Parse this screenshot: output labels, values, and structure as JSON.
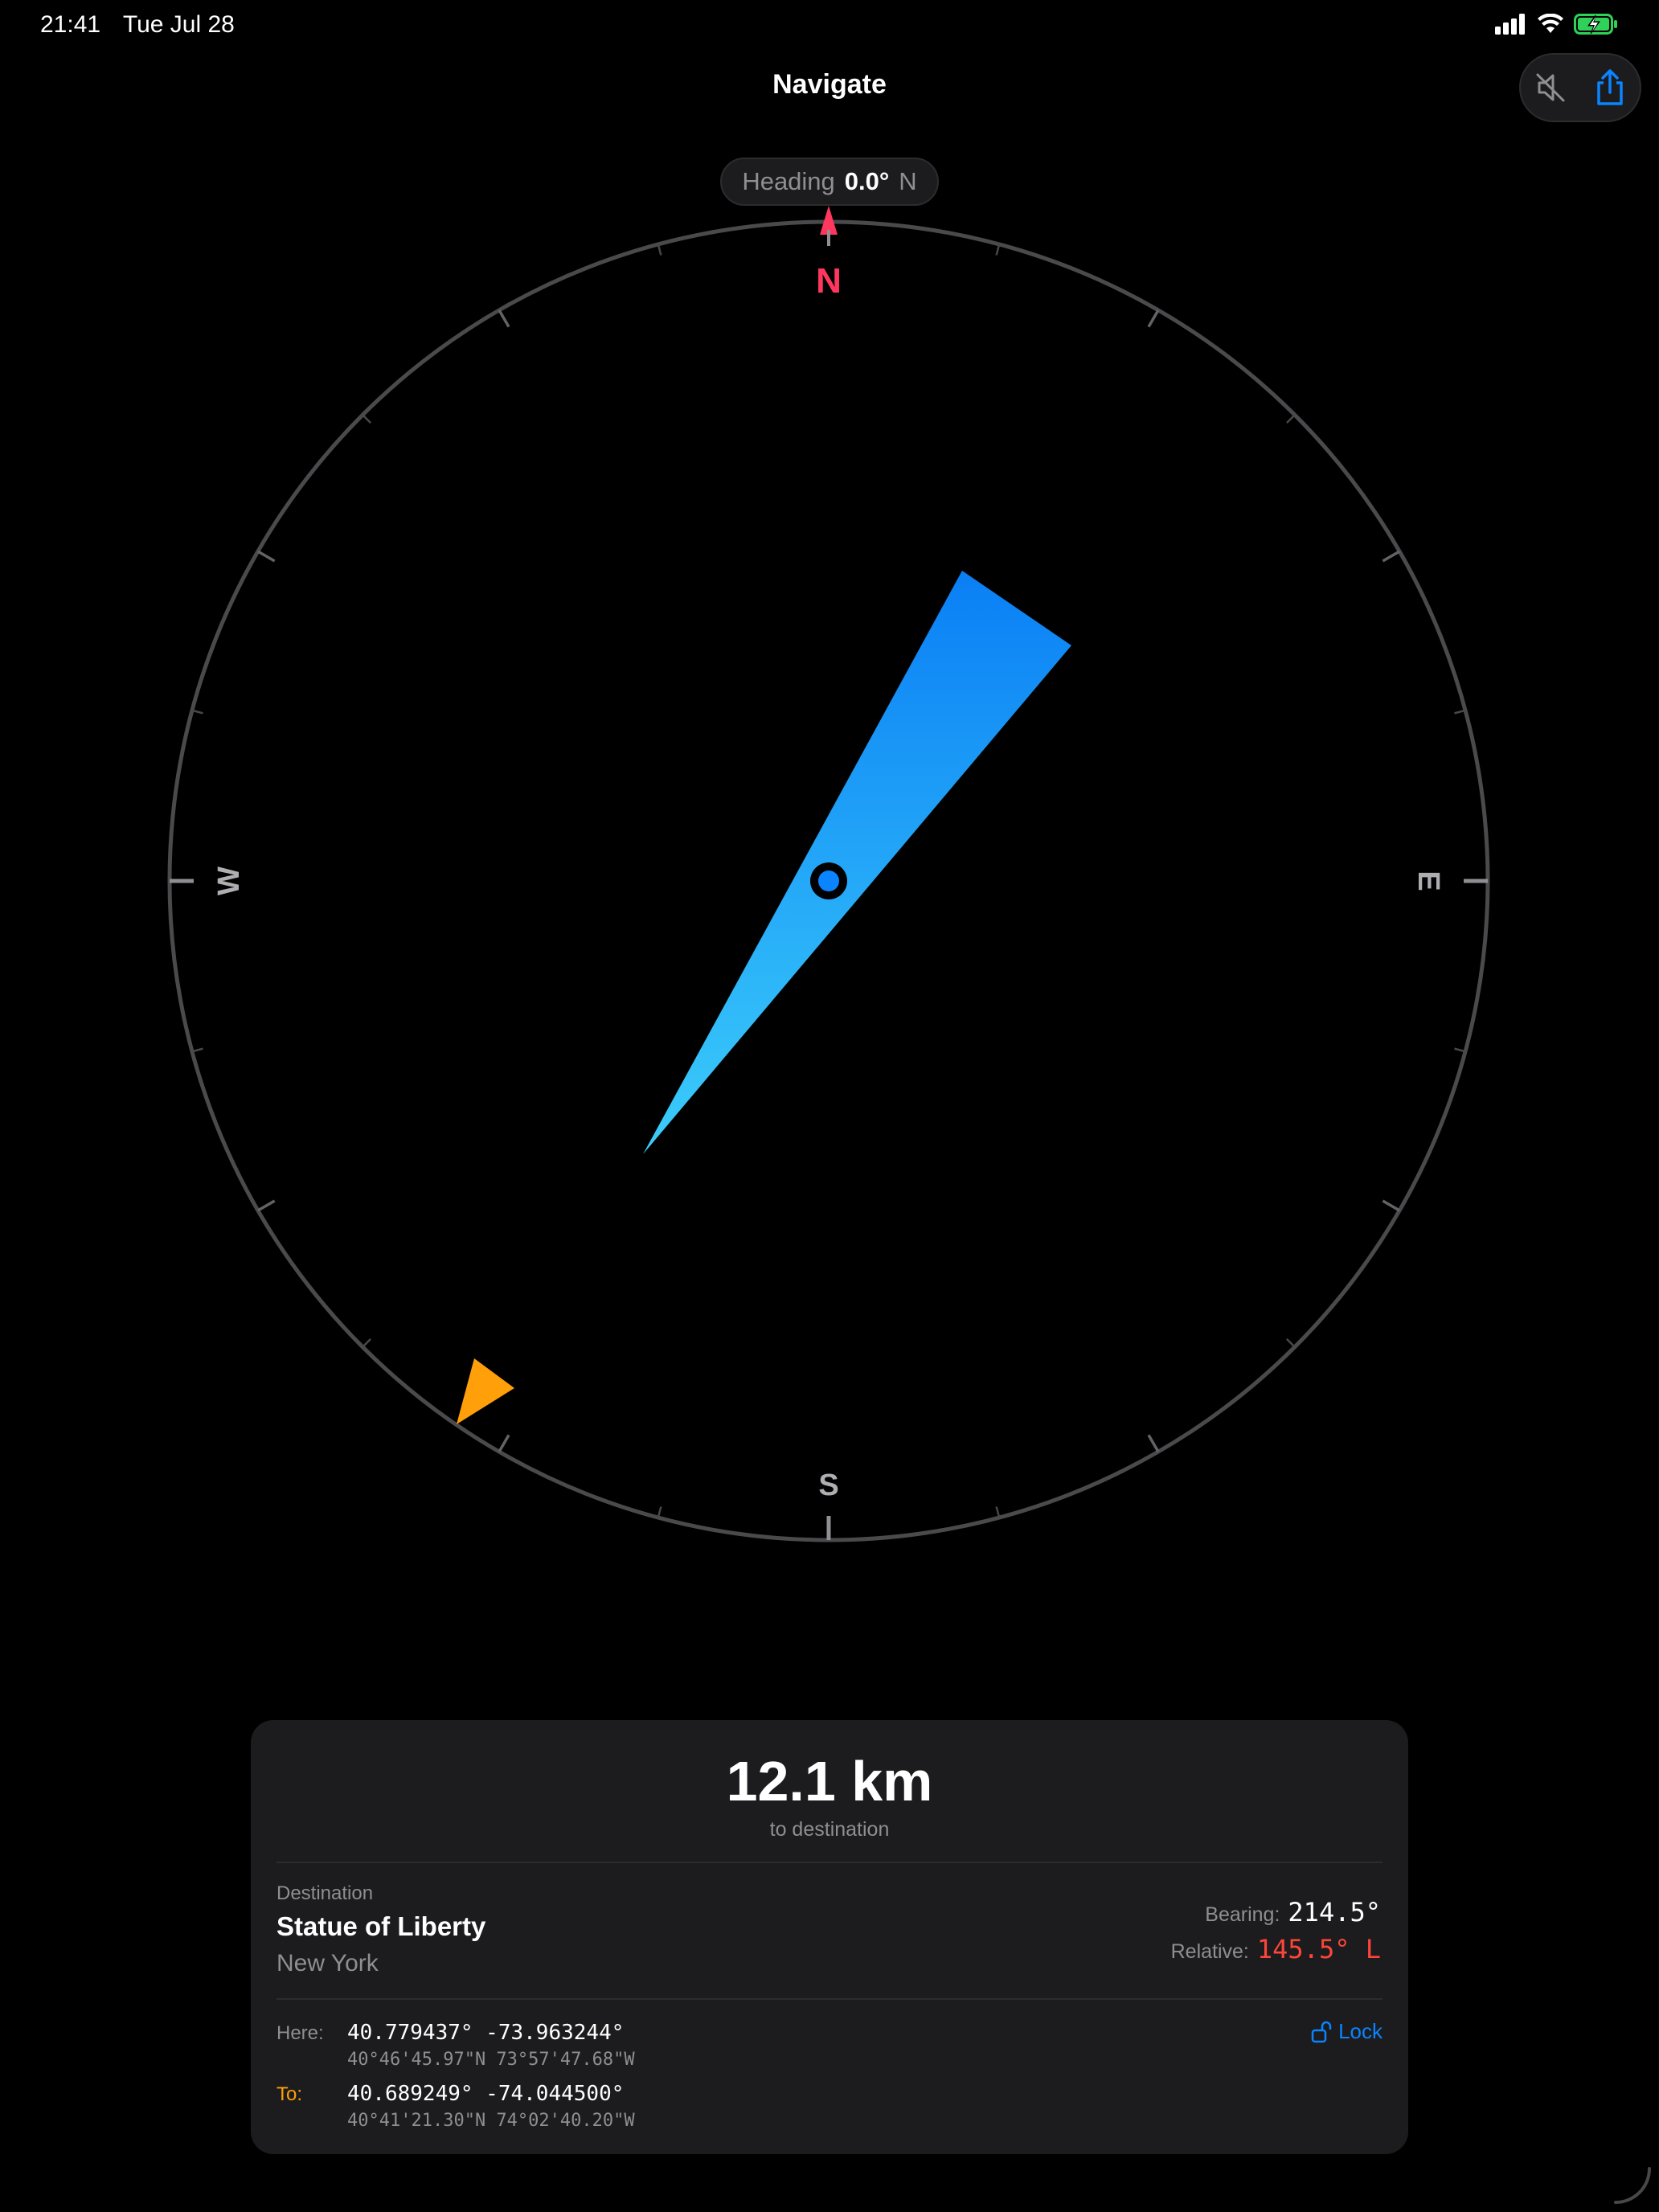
{
  "status_bar": {
    "time": "21:41",
    "date": "Tue Jul 28"
  },
  "nav": {
    "title": "Navigate"
  },
  "toolbar": {
    "mute_icon": "speaker-slash-icon",
    "share_icon": "share-icon"
  },
  "heading": {
    "label": "Heading",
    "value": "0.0°",
    "direction": "N"
  },
  "compass": {
    "cardinals": {
      "n": "N",
      "e": "E",
      "s": "S",
      "w": "W"
    },
    "bearing_deg": 214.5,
    "north_color": "#ff375f",
    "needle_color": "#0a84ff",
    "marker_color": "#ff9f0a"
  },
  "distance": {
    "value": "12.1 km",
    "subtitle": "to destination"
  },
  "destination": {
    "label": "Destination",
    "name": "Statue of Liberty",
    "city": "New York",
    "bearing_label": "Bearing:",
    "bearing_value": "214.5°",
    "relative_label": "Relative:",
    "relative_value": "145.5° L"
  },
  "coords": {
    "here_label": "Here:",
    "here_decimal": "40.779437° -73.963244°",
    "here_dms": "40°46'45.97\"N 73°57'47.68\"W",
    "to_label": "To:",
    "to_decimal": "40.689249° -74.044500°",
    "to_dms": "40°41'21.30\"N 74°02'40.20\"W",
    "lock_label": "Lock"
  },
  "colors": {
    "accent": "#0a84ff",
    "warning": "#ff453a",
    "orange": "#ff9f0a"
  }
}
